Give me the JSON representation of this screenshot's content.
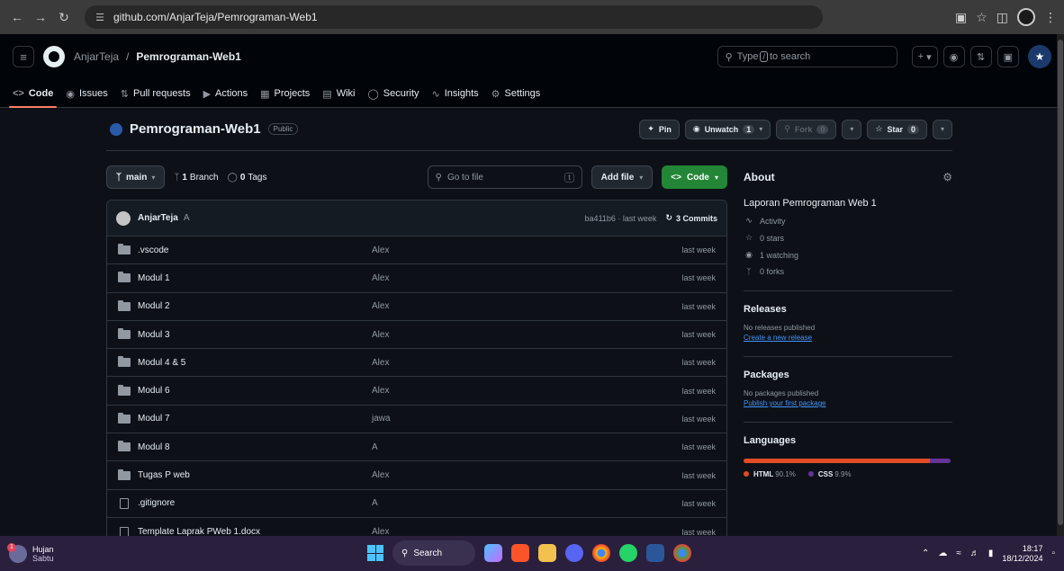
{
  "browser": {
    "url": "github.com/AnjarTeja/Pemrograman-Web1"
  },
  "header": {
    "owner": "AnjarTeja",
    "separator": "/",
    "repo": "Pemrograman-Web1",
    "search_prefix": "Type",
    "search_key": "/",
    "search_suffix": "to search"
  },
  "tabs": [
    {
      "label": "Code",
      "icon": "code-icon"
    },
    {
      "label": "Issues",
      "icon": "issue-icon"
    },
    {
      "label": "Pull requests",
      "icon": "pull-request-icon"
    },
    {
      "label": "Actions",
      "icon": "actions-icon"
    },
    {
      "label": "Projects",
      "icon": "projects-icon"
    },
    {
      "label": "Wiki",
      "icon": "wiki-icon"
    },
    {
      "label": "Security",
      "icon": "shield-icon"
    },
    {
      "label": "Insights",
      "icon": "graph-icon"
    },
    {
      "label": "Settings",
      "icon": "gear-icon"
    }
  ],
  "repo": {
    "title": "Pemrograman-Web1",
    "visibility": "Public",
    "pin_label": "Pin",
    "unwatch_label": "Unwatch",
    "watch_count": "1",
    "fork_label": "Fork",
    "fork_count": "0",
    "star_label": "Star",
    "star_count": "0"
  },
  "file_nav": {
    "branch": "main",
    "branch_count": "1",
    "branch_label": "Branch",
    "tag_count": "0",
    "tag_label": "Tags",
    "goto_placeholder": "Go to file",
    "goto_key": "t",
    "add_file_label": "Add file",
    "code_label": "Code"
  },
  "latest_commit": {
    "author": "AnjarTeja",
    "message": "A",
    "meta": "ba411b6 · last week",
    "commits_label": "3 Commits"
  },
  "files": [
    {
      "type": "folder",
      "name": ".vscode",
      "commit": "Alex",
      "date": "last week"
    },
    {
      "type": "folder",
      "name": "Modul 1",
      "commit": "Alex",
      "date": "last week"
    },
    {
      "type": "folder",
      "name": "Modul 2",
      "commit": "Alex",
      "date": "last week"
    },
    {
      "type": "folder",
      "name": "Modul 3",
      "commit": "Alex",
      "date": "last week"
    },
    {
      "type": "folder",
      "name": "Modul 4 & 5",
      "commit": "Alex",
      "date": "last week"
    },
    {
      "type": "folder",
      "name": "Modul 6",
      "commit": "Alex",
      "date": "last week"
    },
    {
      "type": "folder",
      "name": "Modul 7",
      "commit": "jawa",
      "date": "last week"
    },
    {
      "type": "folder",
      "name": "Modul 8",
      "commit": "A",
      "date": "last week"
    },
    {
      "type": "folder",
      "name": "Tugas P web",
      "commit": "Alex",
      "date": "last week"
    },
    {
      "type": "file",
      "name": ".gitignore",
      "commit": "A",
      "date": "last week"
    },
    {
      "type": "file",
      "name": "Template Laprak PWeb 1.docx",
      "commit": "Alex",
      "date": "last week"
    }
  ],
  "about": {
    "title": "About",
    "description": "Laporan Pemrograman Web 1",
    "activity": "Activity",
    "stars": "0 stars",
    "watching": "1 watching",
    "forks": "0 forks"
  },
  "releases": {
    "title": "Releases",
    "note": "No releases published",
    "link": "Create a new release"
  },
  "packages": {
    "title": "Packages",
    "note": "No packages published",
    "link": "Publish your first package"
  },
  "languages": {
    "title": "Languages",
    "items": [
      {
        "name": "HTML",
        "percent": "90.1%",
        "fraction": 0.901,
        "color": "#e34c26"
      },
      {
        "name": "CSS",
        "percent": "9.9%",
        "fraction": 0.099,
        "color": "#663399"
      }
    ]
  },
  "taskbar": {
    "weather_title": "Hujan",
    "weather_sub": "Sabtu",
    "weather_alert": "1",
    "search_label": "Search",
    "time": "18:17",
    "date": "18/12/2024"
  },
  "colors": {
    "accent_tab": "#f78166",
    "code_button": "#238636",
    "link": "#4493f8"
  }
}
